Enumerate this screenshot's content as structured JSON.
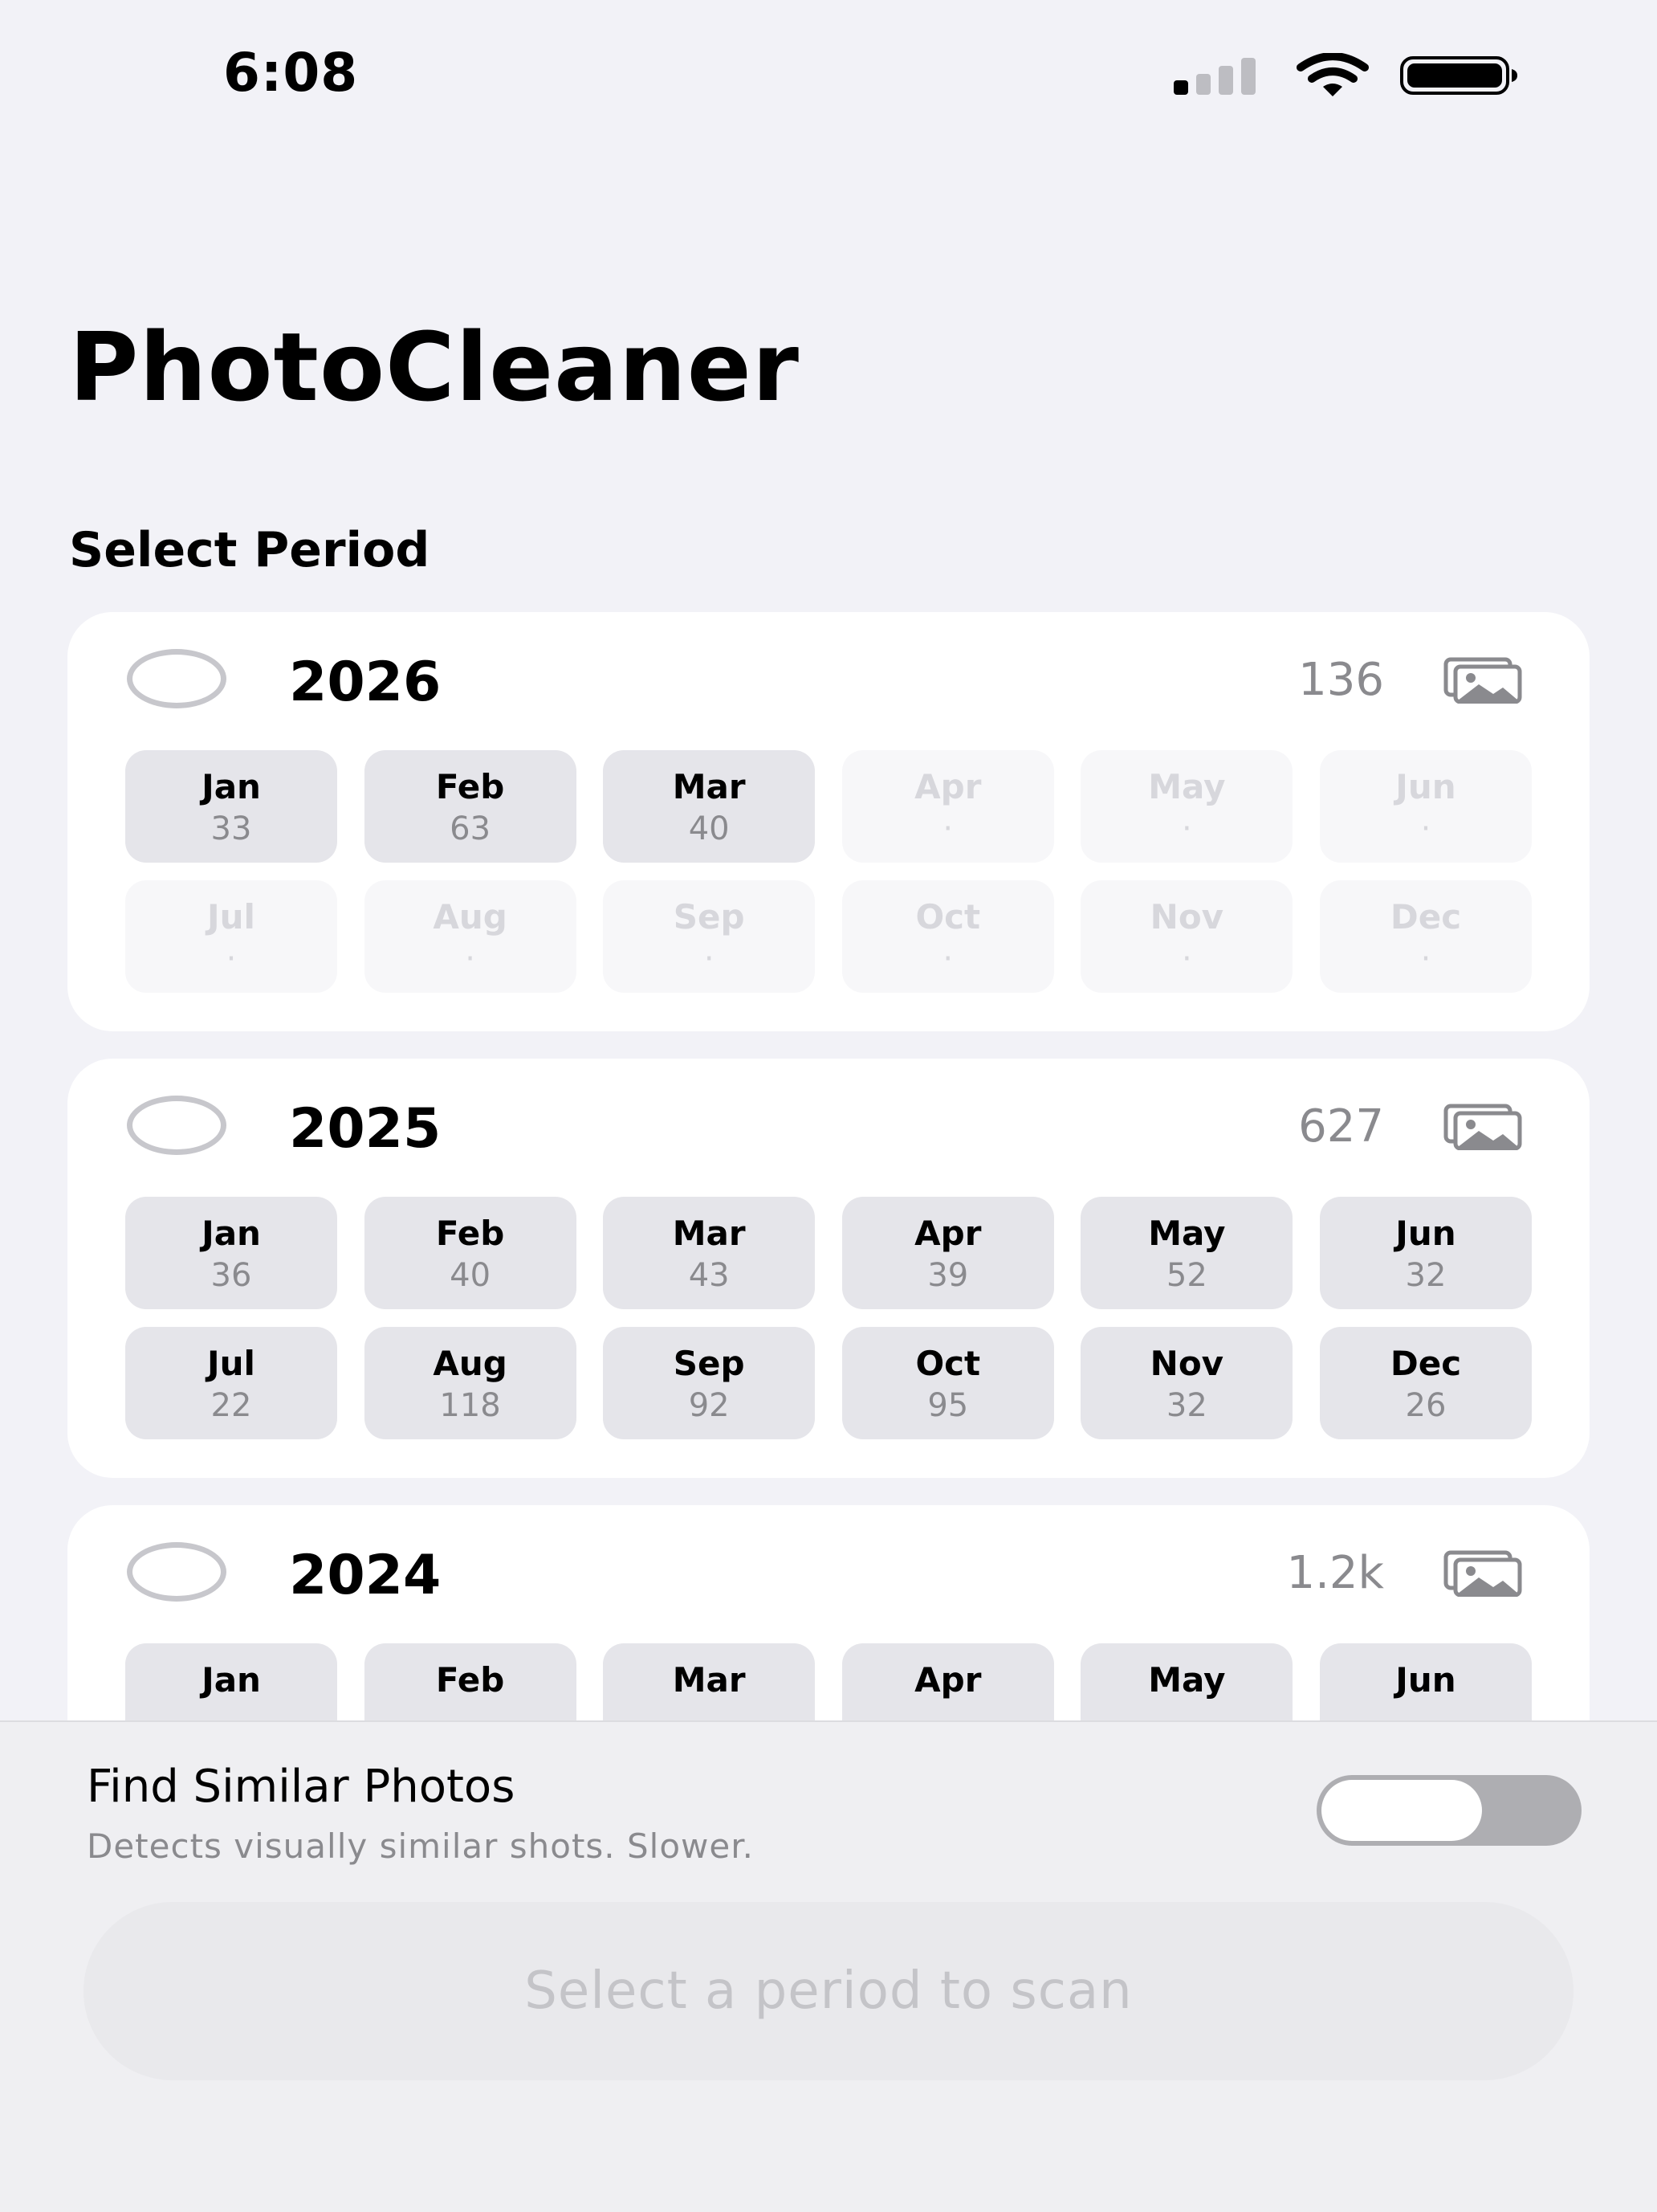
{
  "status_bar": {
    "time": "6:08"
  },
  "app": {
    "title": "PhotoCleaner"
  },
  "section_label": "Select Period",
  "years": [
    {
      "year": "2026",
      "count": "136",
      "months": [
        {
          "name": "Jan",
          "count": "33",
          "enabled": true
        },
        {
          "name": "Feb",
          "count": "63",
          "enabled": true
        },
        {
          "name": "Mar",
          "count": "40",
          "enabled": true
        },
        {
          "name": "Apr",
          "count": "·",
          "enabled": false
        },
        {
          "name": "May",
          "count": "·",
          "enabled": false
        },
        {
          "name": "Jun",
          "count": "·",
          "enabled": false
        },
        {
          "name": "Jul",
          "count": "·",
          "enabled": false
        },
        {
          "name": "Aug",
          "count": "·",
          "enabled": false
        },
        {
          "name": "Sep",
          "count": "·",
          "enabled": false
        },
        {
          "name": "Oct",
          "count": "·",
          "enabled": false
        },
        {
          "name": "Nov",
          "count": "·",
          "enabled": false
        },
        {
          "name": "Dec",
          "count": "·",
          "enabled": false
        }
      ]
    },
    {
      "year": "2025",
      "count": "627",
      "months": [
        {
          "name": "Jan",
          "count": "36",
          "enabled": true
        },
        {
          "name": "Feb",
          "count": "40",
          "enabled": true
        },
        {
          "name": "Mar",
          "count": "43",
          "enabled": true
        },
        {
          "name": "Apr",
          "count": "39",
          "enabled": true
        },
        {
          "name": "May",
          "count": "52",
          "enabled": true
        },
        {
          "name": "Jun",
          "count": "32",
          "enabled": true
        },
        {
          "name": "Jul",
          "count": "22",
          "enabled": true
        },
        {
          "name": "Aug",
          "count": "118",
          "enabled": true
        },
        {
          "name": "Sep",
          "count": "92",
          "enabled": true
        },
        {
          "name": "Oct",
          "count": "95",
          "enabled": true
        },
        {
          "name": "Nov",
          "count": "32",
          "enabled": true
        },
        {
          "name": "Dec",
          "count": "26",
          "enabled": true
        }
      ]
    },
    {
      "year": "2024",
      "count": "1.2k",
      "months": [
        {
          "name": "Jan",
          "count": "",
          "enabled": true
        },
        {
          "name": "Feb",
          "count": "",
          "enabled": true
        },
        {
          "name": "Mar",
          "count": "",
          "enabled": true
        },
        {
          "name": "Apr",
          "count": "",
          "enabled": true
        },
        {
          "name": "May",
          "count": "",
          "enabled": true
        },
        {
          "name": "Jun",
          "count": "",
          "enabled": true
        }
      ]
    }
  ],
  "similar_photos": {
    "title": "Find Similar Photos",
    "subtitle": "Detects visually similar shots. Slower.",
    "enabled": false
  },
  "scan_button": {
    "label": "Select a period to scan",
    "enabled": false
  },
  "colors": {
    "background": "#f2f2f7",
    "card": "#ffffff",
    "month_tile": "#e5e5ea",
    "month_tile_disabled": "#f7f7f9",
    "secondary_text": "#8a8a8e",
    "toggle_off": "#aeaeb2"
  },
  "icons": {
    "signal": "cellular-signal-icon",
    "wifi": "wifi-icon",
    "battery": "battery-icon",
    "year_photos": "photo-stack-icon",
    "year_select": "radio-circle-icon"
  }
}
